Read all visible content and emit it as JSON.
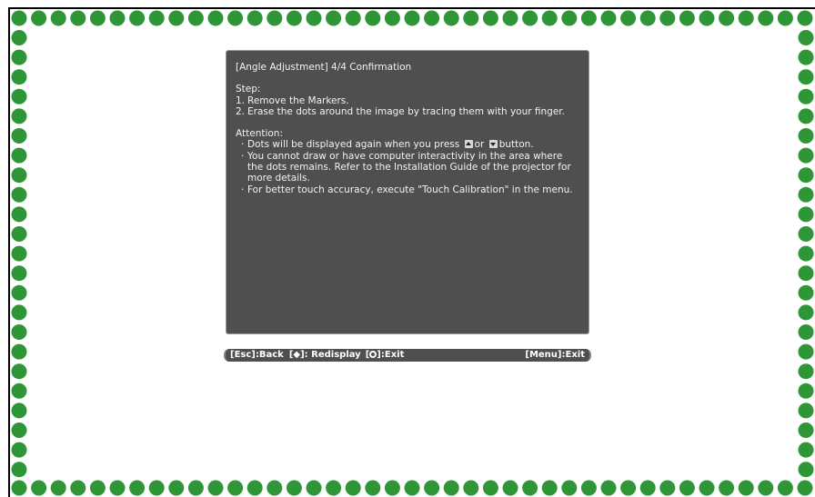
{
  "dialog": {
    "title": "[Angle Adjustment]  4/4  Confirmation",
    "step_heading": "Step:",
    "steps": [
      {
        "num": "1.",
        "text": "Remove the Markers."
      },
      {
        "num": "2.",
        "text": "Erase the dots around the image by tracing them with your finger."
      }
    ],
    "attention_heading": "Attention:",
    "attention": {
      "item1_before": "Dots will be displayed again when you press",
      "item1_or": "or",
      "item1_after": "button.",
      "item2": "You cannot draw or have computer interactivity in the area where the dots remains. Refer to the Installation Guide of the projector for more details.",
      "item3": "For better touch accuracy, execute \"Touch Calibration\" in the menu."
    },
    "bullet": "·"
  },
  "footer": {
    "back_key": "[Esc]",
    "back_label": ":Back",
    "redisplay_key": "[◆]",
    "redisplay_label": ": Redisplay",
    "exit_open": "[",
    "exit_close": "]",
    "exit_label": ":Exit",
    "menu_key": "[Menu]",
    "menu_label": ":Exit"
  },
  "colors": {
    "dot": "#2f9637",
    "dialog_bg": "#4f4f4f",
    "page_bg": "#ffffff"
  },
  "icons": {
    "up_button": "up-arrow-button-icon",
    "down_button": "down-arrow-button-icon",
    "enter": "enter-icon"
  }
}
